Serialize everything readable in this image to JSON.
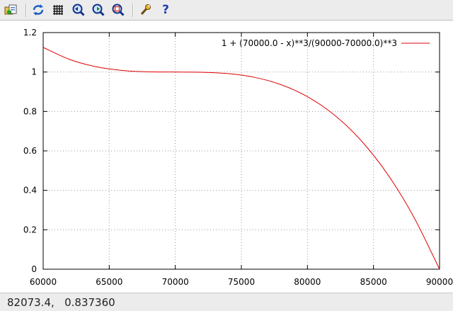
{
  "toolbar": {
    "buttons": [
      {
        "name": "export-icon"
      },
      {
        "name": "replot-icon"
      },
      {
        "name": "grid-icon"
      },
      {
        "name": "zoom-previous-icon"
      },
      {
        "name": "zoom-next-icon"
      },
      {
        "name": "autoscale-icon"
      },
      {
        "name": "settings-icon"
      },
      {
        "name": "help-icon"
      }
    ],
    "help_glyph": "?"
  },
  "status": {
    "text": "82073.4,   0.837360"
  },
  "chart_data": {
    "type": "line",
    "xlim": [
      60000,
      90000
    ],
    "ylim": [
      0,
      1.2
    ],
    "xticks": [
      60000,
      65000,
      70000,
      75000,
      80000,
      85000,
      90000
    ],
    "yticks": [
      0,
      0.2,
      0.4,
      0.6,
      0.8,
      1,
      1.2
    ],
    "xtick_labels": [
      "60000",
      "65000",
      "70000",
      "75000",
      "80000",
      "85000",
      "90000"
    ],
    "ytick_labels": [
      "0",
      "0.2",
      "0.4",
      "0.6",
      "0.8",
      "1",
      "1.2"
    ],
    "grid": true,
    "legend_position": "top-right",
    "series": [
      {
        "name": "1 +  (70000.0 - x)**3/(90000-70000.0)**3",
        "color": "#e00000",
        "x": [
          60000,
          62000,
          64000,
          66000,
          68000,
          70000,
          72000,
          74000,
          76000,
          78000,
          80000,
          82000,
          84000,
          86000,
          88000,
          90000
        ],
        "values": [
          1.125,
          1.064,
          1.027,
          1.008,
          1.001,
          1.0,
          0.999,
          0.992,
          0.973,
          0.936,
          0.875,
          0.784,
          0.657,
          0.488,
          0.271,
          0.0
        ]
      }
    ]
  }
}
